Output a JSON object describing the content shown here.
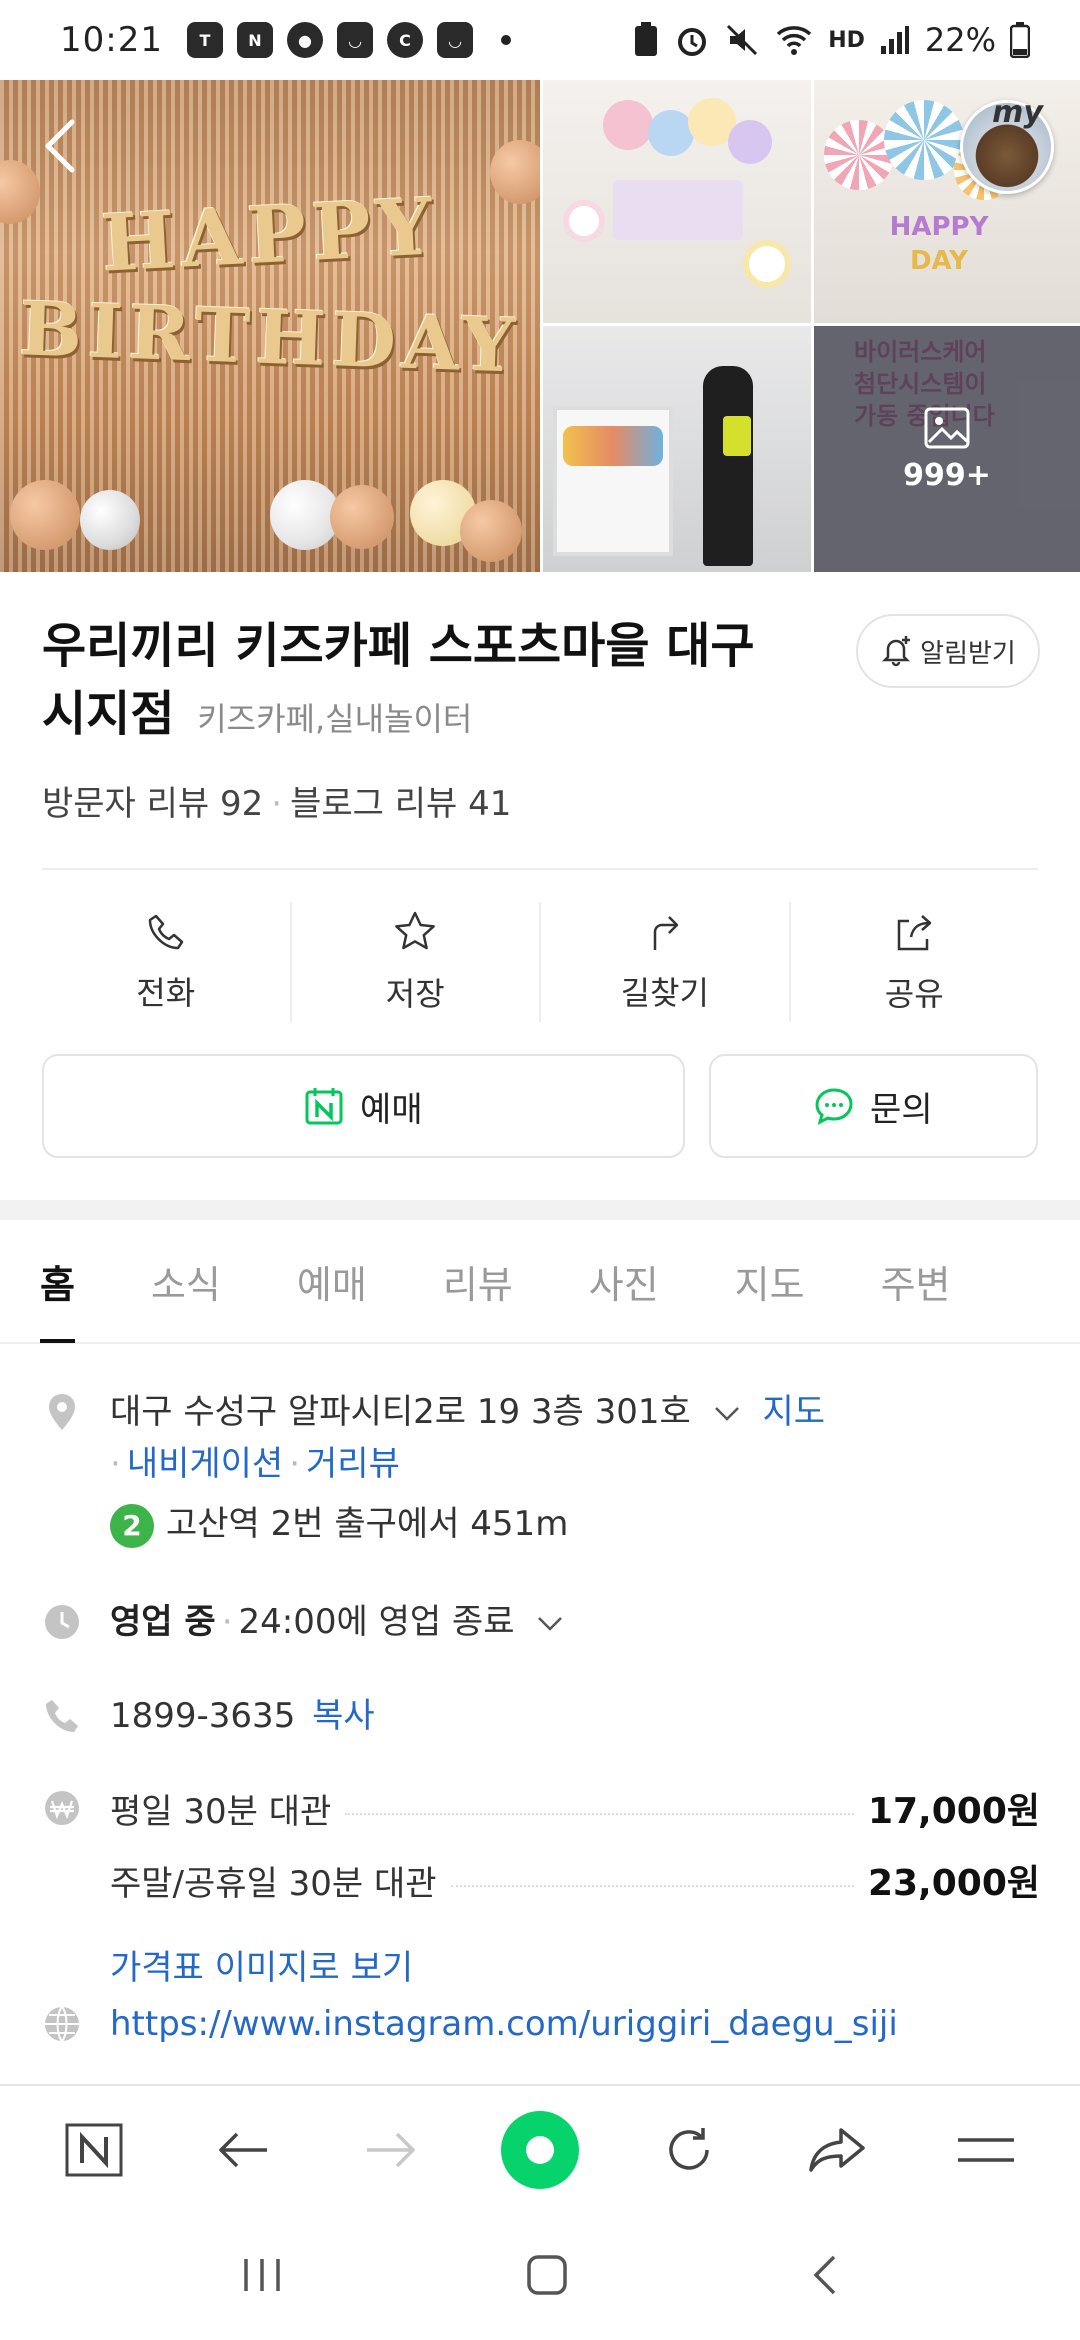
{
  "status_bar": {
    "time": "10:21",
    "battery_percent": "22%",
    "network": "HD"
  },
  "photos": {
    "main_banner_line1": "HAPPY",
    "main_banner_line2": "BIRTHDAY",
    "more_count": "999+",
    "profile_label": "my"
  },
  "place": {
    "name": "우리끼리 키즈카페 스포츠마을 대구 시지점",
    "category": "키즈카페,실내놀이터",
    "alarm_label": "알림받기",
    "visitor_reviews": "방문자 리뷰 92",
    "blog_reviews": "블로그 리뷰 41"
  },
  "actions": [
    {
      "label": "전화",
      "icon": "phone-icon"
    },
    {
      "label": "저장",
      "icon": "star-icon"
    },
    {
      "label": "길찾기",
      "icon": "directions-icon"
    },
    {
      "label": "공유",
      "icon": "share-icon"
    }
  ],
  "buttons": {
    "book_label": "예매",
    "ask_label": "문의"
  },
  "tabs": [
    "홈",
    "소식",
    "예매",
    "리뷰",
    "사진",
    "지도",
    "주변"
  ],
  "details": {
    "address": "대구 수성구 알파시티2로 19 3층 301호",
    "map_link": "지도",
    "navigation_link": "내비게이션",
    "streetview_link": "거리뷰",
    "subway_line": "2",
    "subway_text": "고산역 2번 출구에서 451m",
    "status": "영업 중",
    "hours": "24:00에 영업 종료",
    "phone": "1899-3635",
    "copy_label": "복사",
    "prices": [
      {
        "label": "평일 30분 대관",
        "value": "17,000원"
      },
      {
        "label": "주말/공휴일 30분 대관",
        "value": "23,000원"
      }
    ],
    "price_image_link": "가격표 이미지로 보기",
    "website": "https://www.instagram.com/uriggiri_daegu_siji"
  },
  "colors": {
    "accent_green": "#03c75a",
    "link_blue": "#2469c7",
    "browser_green": "#06d36b"
  }
}
